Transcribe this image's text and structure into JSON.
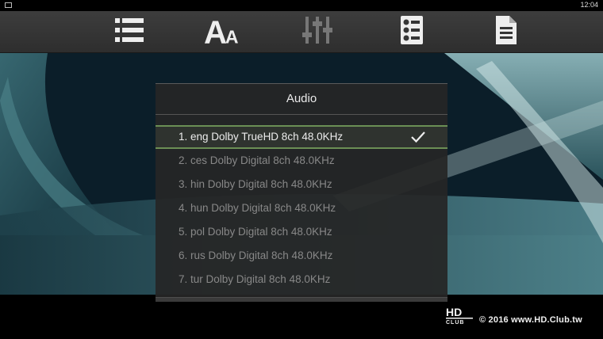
{
  "status_bar": {
    "time": "12:04"
  },
  "toolbar": {
    "buttons": [
      {
        "icon": "list-icon"
      },
      {
        "icon": "subtitle-font-icon"
      },
      {
        "icon": "equalizer-icon"
      },
      {
        "icon": "numbered-list-icon"
      },
      {
        "icon": "document-icon"
      }
    ]
  },
  "dialog": {
    "title": "Audio",
    "items": [
      {
        "label": "1. eng Dolby TrueHD 8ch 48.0KHz",
        "selected": true
      },
      {
        "label": "2. ces Dolby Digital 8ch 48.0KHz",
        "selected": false
      },
      {
        "label": "3. hin Dolby Digital 8ch 48.0KHz",
        "selected": false
      },
      {
        "label": "4. hun Dolby Digital 8ch 48.0KHz",
        "selected": false
      },
      {
        "label": "5. pol Dolby Digital 8ch 48.0KHz",
        "selected": false
      },
      {
        "label": "6. rus Dolby Digital 8ch 48.0KHz",
        "selected": false
      },
      {
        "label": "7. tur Dolby Digital 8ch 48.0KHz",
        "selected": false
      }
    ]
  },
  "watermark": {
    "logo_text": "HD CLUB",
    "text": "© 2016  www.HD.Club.tw"
  },
  "colors": {
    "selection_border": "#6b8f55",
    "toolbar_bg": "#353535",
    "dialog_bg": "#262626"
  }
}
